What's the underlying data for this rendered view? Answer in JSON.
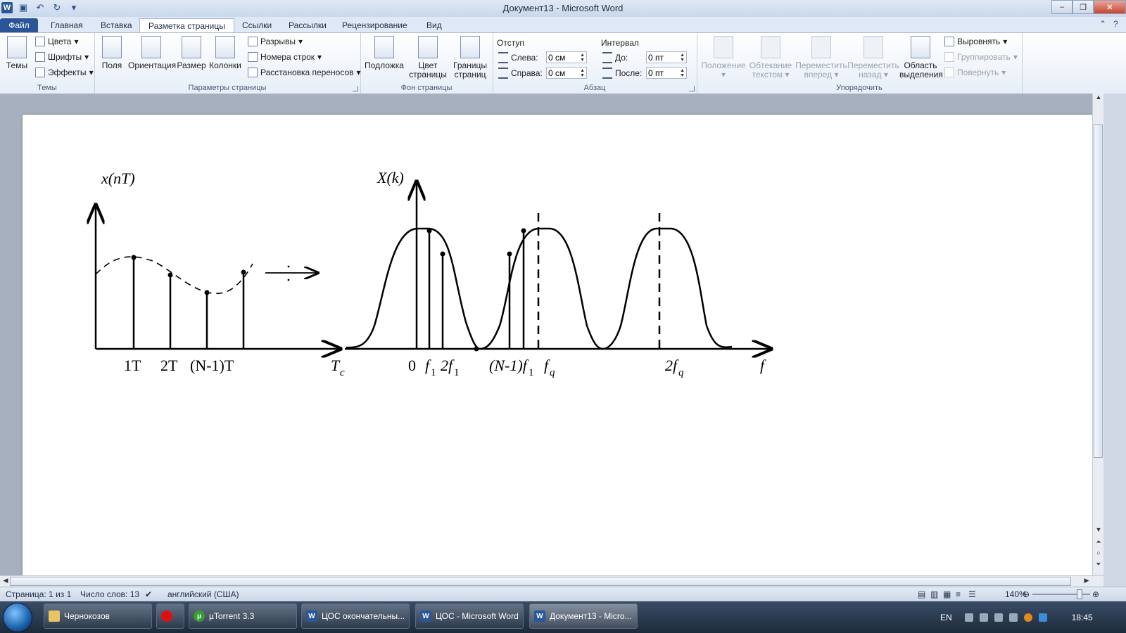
{
  "window": {
    "title": "Документ13 - Microsoft Word",
    "app_icon": "word-app-icon",
    "minimize": "‒",
    "maximize": "❐",
    "close": "✕"
  },
  "tabs": [
    "Файл",
    "Главная",
    "Вставка",
    "Разметка страницы",
    "Ссылки",
    "Рассылки",
    "Рецензирование",
    "Вид"
  ],
  "active_tab": "Разметка страницы",
  "ribbon": {
    "themes": {
      "label": "Темы",
      "button": "Темы",
      "colors": "Цвета",
      "fonts": "Шрифты",
      "effects": "Эффекты"
    },
    "page_setup": {
      "label": "Параметры страницы",
      "margins": "Поля",
      "orientation": "Ориентация",
      "size": "Размер",
      "columns": "Колонки",
      "breaks": "Разрывы",
      "line_numbers": "Номера строк",
      "hyphenation": "Расстановка переносов"
    },
    "page_background": {
      "label": "Фон страницы",
      "watermark": "Подложка",
      "page_color_1": "Цвет",
      "page_color_2": "страницы",
      "page_borders_1": "Границы",
      "page_borders_2": "страниц"
    },
    "paragraph": {
      "label": "Абзац",
      "indent": "Отступ",
      "left": "Слева:",
      "left_value": "0 см",
      "right": "Справа:",
      "right_value": "0 см",
      "spacing": "Интервал",
      "before": "До:",
      "before_value": "0 пт",
      "after": "После:",
      "after_value": "0 пт"
    },
    "arrange": {
      "label": "Упорядочить",
      "position": "Положение",
      "wrap_1": "Обтекание",
      "wrap_2": "текстом",
      "forward_1": "Переместить",
      "forward_2": "вперед",
      "backward_1": "Переместить",
      "backward_2": "назад",
      "selection_1": "Область",
      "selection_2": "выделения",
      "align": "Выровнять",
      "group": "Группировать",
      "rotate": "Повернуть"
    }
  },
  "figure": {
    "left_ylabel": "x(nT)",
    "left_ticks": [
      "1T",
      "2T",
      "(N-1)T"
    ],
    "left_xlabel_main": "T",
    "left_xlabel_sub": "c",
    "right_ylabel": "X(k)",
    "right_tick_zero": "0",
    "right_tick_f1_main": "f",
    "right_tick_f1_sub": "1",
    "right_tick_2f1_main": "2f",
    "right_tick_2f1_sub": "1",
    "right_tick_n1f1_main": "(N-1)f",
    "right_tick_n1f1_sub": "1",
    "right_tick_fq_main": "f",
    "right_tick_fq_sub": "q",
    "right_tick_2fq_main": "2f",
    "right_tick_2fq_sub": "q",
    "right_xlabel": "f"
  },
  "statusbar": {
    "page": "Страница: 1 из 1",
    "words": "Число слов: 13",
    "language": "английский (США)",
    "zoom": "140%"
  },
  "taskbar": {
    "items": [
      "Чернокозов",
      "µTorrent 3.3",
      "ЦОС окончательны...",
      "ЦОС - Microsoft Word",
      "Документ13 - Micro..."
    ],
    "lang": "EN",
    "clock": "18:45"
  }
}
